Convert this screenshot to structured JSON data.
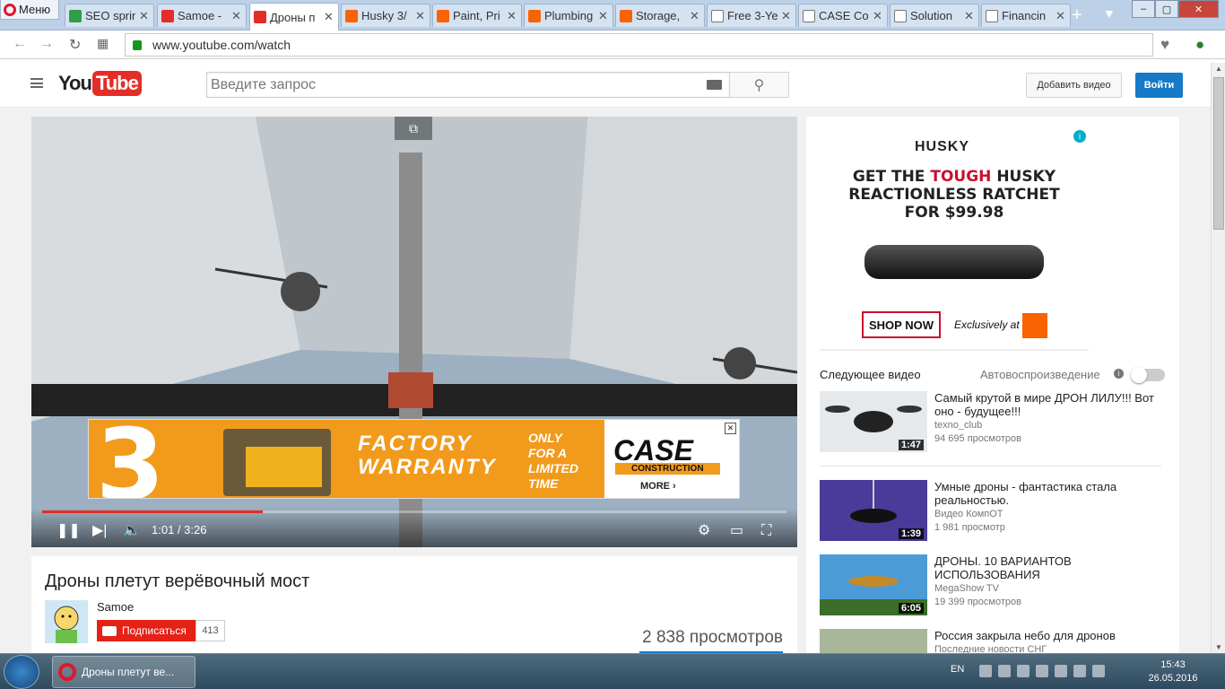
{
  "browser": {
    "menu_label": "Меню",
    "tabs": [
      {
        "title": "SEO sprin",
        "icon": "seo"
      },
      {
        "title": "Samoe -",
        "icon": "youtube"
      },
      {
        "title": "Дроны п",
        "icon": "youtube",
        "active": true
      },
      {
        "title": "Husky 3/",
        "icon": "homedepot"
      },
      {
        "title": "Paint, Pri",
        "icon": "homedepot"
      },
      {
        "title": "Plumbing",
        "icon": "homedepot"
      },
      {
        "title": "Storage,",
        "icon": "homedepot"
      },
      {
        "title": "Free 3-Ye",
        "icon": "document"
      },
      {
        "title": "CASE Co",
        "icon": "document"
      },
      {
        "title": "Solution",
        "icon": "document"
      },
      {
        "title": "Financin",
        "icon": "document"
      }
    ],
    "url": "www.youtube.com/watch"
  },
  "youtube": {
    "logo_you": "You",
    "logo_tube": "Tube",
    "search_placeholder": "Введите запрос",
    "upload_label": "Добавить видео",
    "signin_label": "Войти"
  },
  "player": {
    "time": "1:01 / 3:26",
    "progress_fraction": 0.296,
    "ad": {
      "big": "3",
      "line1": "FACTORY",
      "line2": "WARRANTY",
      "only": "ONLY\nFOR A\nLIMITED\nTIME",
      "brand": "CASE",
      "brand_sub": "CONSTRUCTION",
      "more": "MORE ›"
    }
  },
  "video_info": {
    "title": "Дроны плетут верёвочный мост",
    "channel": "Samoe",
    "subscribe_label": "Подписаться",
    "subscriber_count": "413",
    "views": "2 838 просмотров"
  },
  "sidebar": {
    "ad": {
      "brand": "HUSKY",
      "line1": "GET THE",
      "tough": "TOUGH",
      "line1b": "HUSKY",
      "line2": "REACTIONLESS RATCHET",
      "line3": "FOR $99.98",
      "shop": "SHOP NOW",
      "exclusive": "Exclusively at"
    },
    "next_label": "Следующее видео",
    "autoplay_label": "Автовоспроизведение",
    "videos": [
      {
        "title": "Самый крутой в мире ДРОН ЛИЛУ!!! Вот оно - будущее!!!",
        "channel": "texno_club",
        "views": "94 695 просмотров",
        "duration": "1:47"
      },
      {
        "title": "Умные дроны - фантастика стала реальностью.",
        "channel": "Видео КомпОТ",
        "views": "1 981 просмотр",
        "duration": "1:39"
      },
      {
        "title": "ДРОНЫ. 10 ВАРИАНТОВ ИСПОЛЬЗОВАНИЯ",
        "channel": "MegaShow TV",
        "views": "19 399 просмотров",
        "duration": "6:05"
      },
      {
        "title": "Россия закрыла небо для дронов",
        "channel": "Последние новости СНГ",
        "views": "",
        "duration": ""
      }
    ]
  },
  "taskbar": {
    "item_label": "Дроны плетут ве...",
    "lang": "EN",
    "time": "15:43",
    "date": "26.05.2016"
  }
}
